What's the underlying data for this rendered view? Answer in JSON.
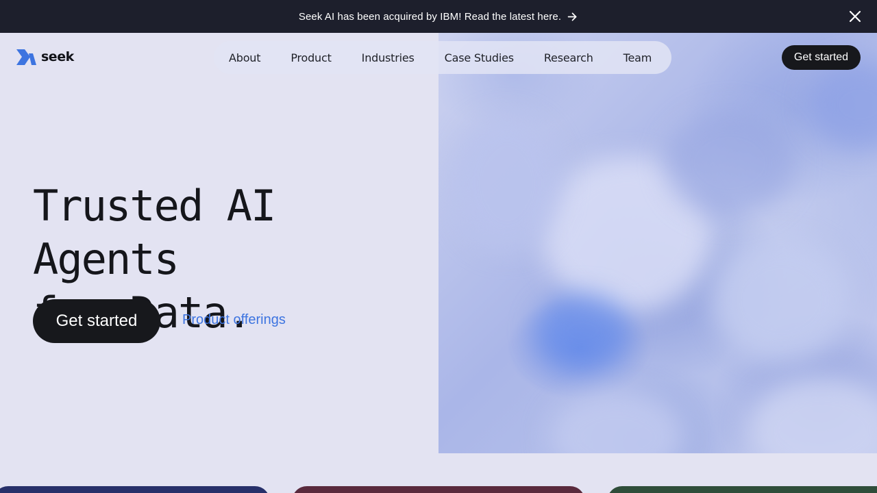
{
  "banner": {
    "text": "Seek AI has been acquired by IBM! Read the latest here.",
    "arrow_icon": "arrow-right-icon",
    "close_icon": "close-icon",
    "background": "#1d1f2c"
  },
  "logo": {
    "text": "seek",
    "accent": "#3d74e0"
  },
  "nav": {
    "items": [
      {
        "label": "About"
      },
      {
        "label": "Product"
      },
      {
        "label": "Industries"
      },
      {
        "label": "Case Studies"
      },
      {
        "label": "Research"
      },
      {
        "label": "Team"
      }
    ]
  },
  "header": {
    "cta_label": "Get started"
  },
  "hero": {
    "title_line_1": "Trusted AI Agents",
    "title_line_2": "for Data.",
    "cta_label": "Get started",
    "secondary_link": "Product offerings",
    "link_color": "#3d74e0"
  },
  "cards": {
    "colors": [
      "#27306a",
      "#5a2a3d",
      "#2f4d3a"
    ]
  }
}
